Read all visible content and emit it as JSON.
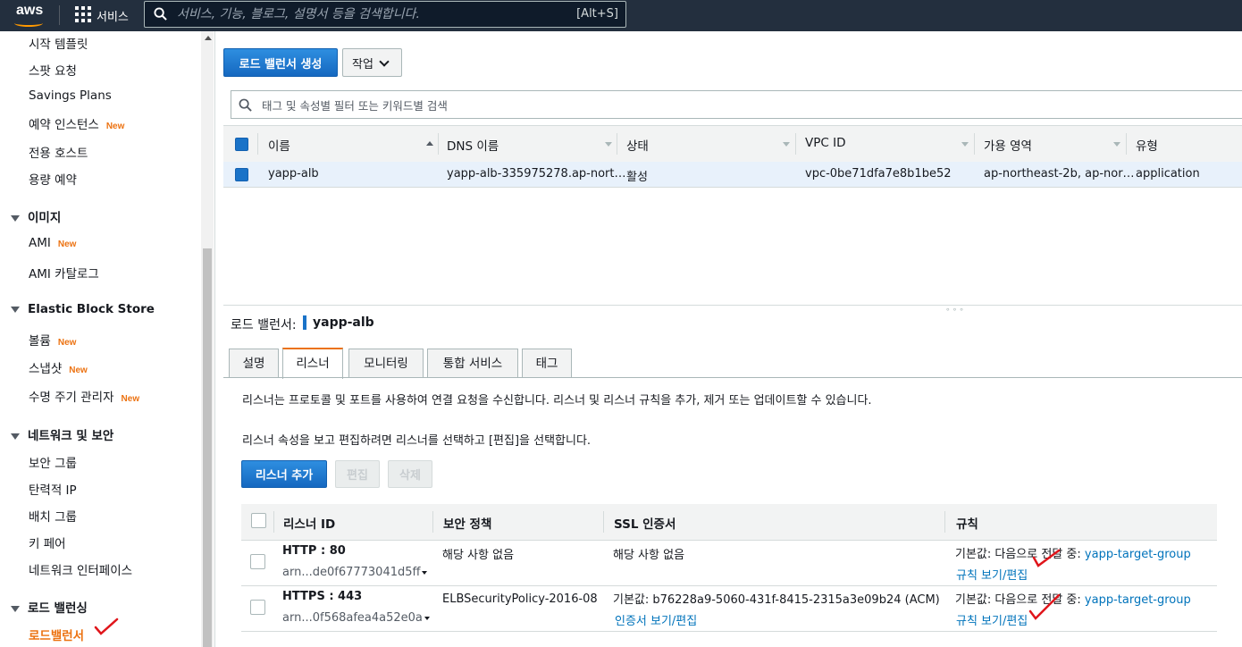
{
  "topbar": {
    "logo": "aws",
    "services_label": "서비스",
    "search_placeholder": "서비스, 기능, 블로그, 설명서 등을 검색합니다.",
    "search_shortcut": "[Alt+S]"
  },
  "sidebar": {
    "new_badge": "New",
    "items_top": [
      {
        "label": "시작 템플릿",
        "new": false
      },
      {
        "label": "스팟 요청",
        "new": false
      },
      {
        "label": "Savings Plans",
        "new": false
      },
      {
        "label": "예약 인스턴스",
        "new": true
      },
      {
        "label": "전용 호스트",
        "new": false
      },
      {
        "label": "용량 예약",
        "new": false
      }
    ],
    "images": {
      "heading": "이미지",
      "items": [
        {
          "label": "AMI",
          "new": true
        },
        {
          "label": "AMI 카탈로그",
          "new": false
        }
      ]
    },
    "ebs": {
      "heading": "Elastic Block Store",
      "items": [
        {
          "label": "볼륨",
          "new": true
        },
        {
          "label": "스냅샷",
          "new": true
        },
        {
          "label": "수명 주기 관리자",
          "new": true
        }
      ]
    },
    "network": {
      "heading": "네트워크 및 보안",
      "items": [
        {
          "label": "보안 그룹"
        },
        {
          "label": "탄력적 IP"
        },
        {
          "label": "배치 그룹"
        },
        {
          "label": "키 페어"
        },
        {
          "label": "네트워크 인터페이스"
        }
      ]
    },
    "lb": {
      "heading": "로드 밸런싱",
      "active_item": "로드밸런서"
    }
  },
  "toolbar": {
    "create_label": "로드 밸런서 생성",
    "actions_label": "작업"
  },
  "filter": {
    "placeholder": "태그 및 속성별 필터 또는 키워드별 검색"
  },
  "lb_table": {
    "columns": [
      "이름",
      "DNS 이름",
      "상태",
      "VPC ID",
      "가용 영역",
      "유형"
    ],
    "rows": [
      {
        "name": "yapp-alb",
        "dns": "yapp-alb-335975278.ap-nort…",
        "state": "활성",
        "vpc": "vpc-0be71dfa7e8b1be52",
        "az": "ap-northeast-2b, ap-nor…",
        "type": "application"
      }
    ]
  },
  "detail": {
    "label": "로드 밸런서:",
    "name": "yapp-alb",
    "tabs": [
      "설명",
      "리스너",
      "모니터링",
      "통합 서비스",
      "태그"
    ],
    "active_tab": "리스너",
    "desc1": "리스너는 프로토콜 및 포트를 사용하여 연결 요청을 수신합니다. 리스너 및 리스너 규칙을 추가, 제거 또는 업데이트할 수 있습니다.",
    "desc2": "리스너 속성을 보고 편집하려면 리스너를 선택하고 [편집]을 선택합니다.",
    "add_label": "리스너 추가",
    "edit_label": "편집",
    "delete_label": "삭제"
  },
  "listener_table": {
    "columns": [
      "리스너 ID",
      "보안 정책",
      "SSL 인증서",
      "규칙"
    ],
    "rows": [
      {
        "proto": "HTTP : 80",
        "arn": "arn...de0f67773041d5ff",
        "policy": "해당 사항 없음",
        "ssl": "해당 사항 없음",
        "ssl_link": "",
        "rule_prefix": "기본값:  다음으로 전달 중:",
        "rule_target": "yapp-target-group",
        "rule_link": "규칙 보기/편집"
      },
      {
        "proto": "HTTPS : 443",
        "arn": "arn...0f568afea4a52e0a",
        "policy": "ELBSecurityPolicy-2016-08",
        "ssl": "기본값:  b76228a9-5060-431f-8415-2315a3e09b24 (ACM)",
        "ssl_link": "인증서 보기/편집",
        "rule_prefix": "기본값:  다음으로 전달 중:",
        "rule_target": "yapp-target-group",
        "rule_link": "규칙 보기/편집"
      }
    ]
  },
  "colors": {
    "header": "#232f3e",
    "accent": "#ec7211",
    "primary": "#1a73c8",
    "link": "#0073bb",
    "checkmark": "#e0151b"
  }
}
